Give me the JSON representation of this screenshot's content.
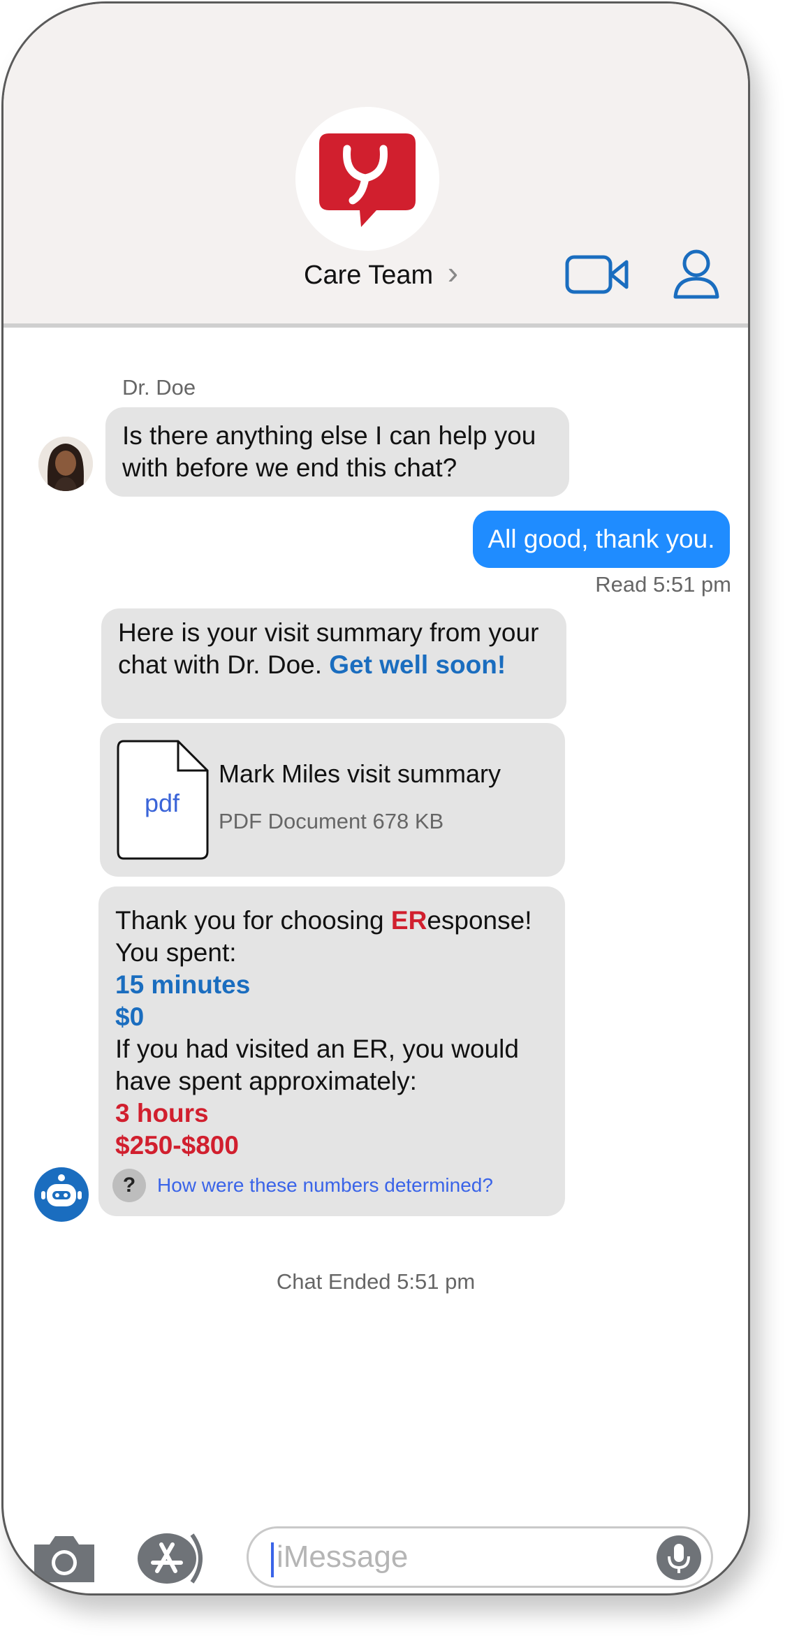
{
  "header": {
    "contact_name": "Care Team",
    "chevron": "›",
    "icons": [
      "stethoscope-logo-icon",
      "video-camera-icon",
      "person-icon"
    ]
  },
  "chat": {
    "sender_name": "Dr. Doe",
    "incoming_message": "Is there anything else I can help you with before we end this chat?",
    "outgoing_message": "All good, thank you.",
    "read_status": "Read 5:51 pm",
    "summary_message_prefix": "Here is your visit summary from your chat with Dr. Doe. ",
    "summary_message_highlight": "Get well soon!",
    "attachment": {
      "icon_label": "pdf",
      "title": "Mark Miles visit summary",
      "subtitle": "PDF Document 678 KB"
    },
    "bot_message": {
      "thank_prefix": "Thank you for choosing ",
      "brand_red": "ER",
      "brand_rest": "esponse!",
      "spent_label": "You spent:",
      "time_spent": "15 minutes",
      "cost_spent": "$0",
      "er_compare": "If you had visited an ER, you would have spent approximately:",
      "er_time": "3 hours",
      "er_cost": "$250-$800",
      "help_q": "?",
      "help_link": "How were these numbers determined?"
    },
    "chat_ended": "Chat Ended 5:51 pm"
  },
  "compose": {
    "placeholder": "iMessage"
  },
  "colors": {
    "brand_red": "#d11f2e",
    "accent_blue": "#1a6dbf",
    "bubble_out": "#1f8cff",
    "bubble_in": "#e4e4e4"
  }
}
